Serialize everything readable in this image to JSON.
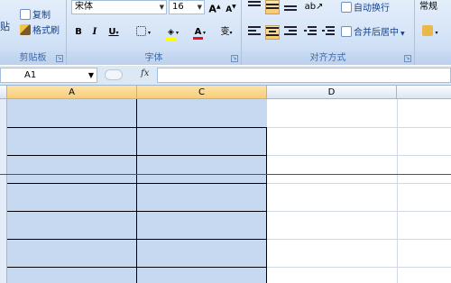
{
  "clipboard": {
    "paste_label": "贴",
    "copy_label": "复制",
    "format_painter_label": "格式刷",
    "group_label": "剪贴板"
  },
  "font": {
    "font_name": "宋体",
    "font_size": "16",
    "bold": "B",
    "italic": "I",
    "underline": "U",
    "grow": "A",
    "shrink": "A",
    "font_color_glyph": "A",
    "phonetic_glyph": "变",
    "group_label": "字体"
  },
  "alignment": {
    "wrap_text_label": "自动换行",
    "merge_center_label": "合并后居中",
    "group_label": "对齐方式"
  },
  "number": {
    "format_value": "常规"
  },
  "formula_bar": {
    "cell_ref": "A1",
    "fx_label": "fx",
    "content": ""
  },
  "sheet": {
    "columns": [
      "A",
      "C",
      "D"
    ]
  },
  "colors": {
    "selection": "#c6d9f0",
    "font_color_underline": "#e8121e",
    "fill_color_underline": "#ffff00",
    "annotation_line": "#c0272d"
  }
}
